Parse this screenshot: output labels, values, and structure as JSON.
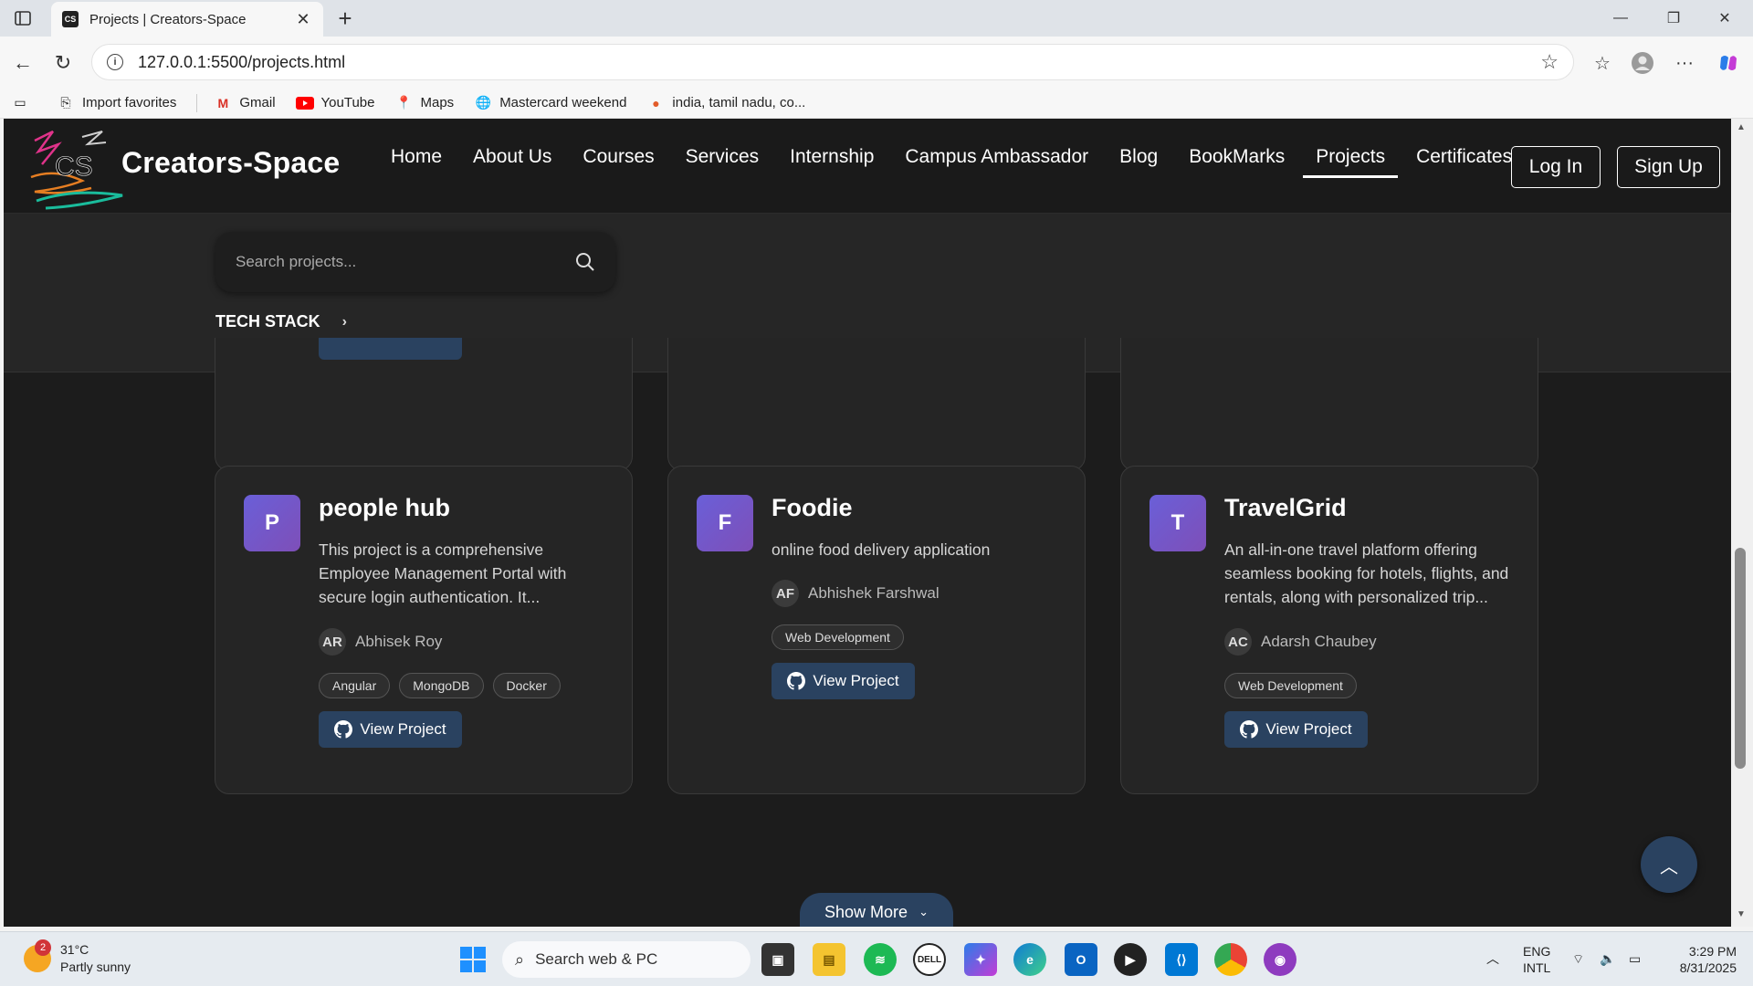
{
  "browser": {
    "tab_title": "Projects | Creators-Space",
    "url": "127.0.0.1:5500/projects.html",
    "bookmarks": [
      "Import favorites",
      "Gmail",
      "YouTube",
      "Maps",
      "Mastercard weekend",
      "india, tamil nadu, co..."
    ]
  },
  "site": {
    "brand": "Creators-Space",
    "logo_letters": "CS",
    "nav": [
      "Home",
      "About Us",
      "Courses",
      "Services",
      "Internship",
      "Campus Ambassador",
      "Blog",
      "BookMarks",
      "Projects",
      "Certificates"
    ],
    "active_nav": "Projects",
    "login_label": "Log In",
    "signup_label": "Sign Up"
  },
  "filters": {
    "search_placeholder": "Search projects...",
    "tech_stack_label": "TECH STACK"
  },
  "projects": [
    {
      "initial": "P",
      "title": "people hub",
      "description": "This project is a comprehensive Employee Management Portal with secure login authentication. It...",
      "author_initials": "AR",
      "author": "Abhisek Roy",
      "tags": [
        "Angular",
        "MongoDB",
        "Docker"
      ],
      "button": "View Project"
    },
    {
      "initial": "F",
      "title": "Foodie",
      "description": "online food delivery application",
      "author_initials": "AF",
      "author": "Abhishek Farshwal",
      "tags": [
        "Web Development"
      ],
      "button": "View Project"
    },
    {
      "initial": "T",
      "title": "TravelGrid",
      "description": "An all-in-one travel platform offering seamless booking for hotels, flights, and rentals, along with personalized trip...",
      "author_initials": "AC",
      "author": "Adarsh Chaubey",
      "tags": [
        "Web Development"
      ],
      "button": "View Project"
    }
  ],
  "show_more_label": "Show More",
  "taskbar": {
    "weather_temp": "31°C",
    "weather_desc": "Partly sunny",
    "weather_badge": "2",
    "search_label": "Search web & PC",
    "lang": "ENG",
    "lang_sub": "INTL",
    "time": "3:29 PM",
    "date": "8/31/2025"
  },
  "colors": {
    "page_bg": "#1c1c1c",
    "card_bg": "#252525",
    "button_blue": "#2a4260",
    "avatar_purple": "#6a5fd8"
  }
}
